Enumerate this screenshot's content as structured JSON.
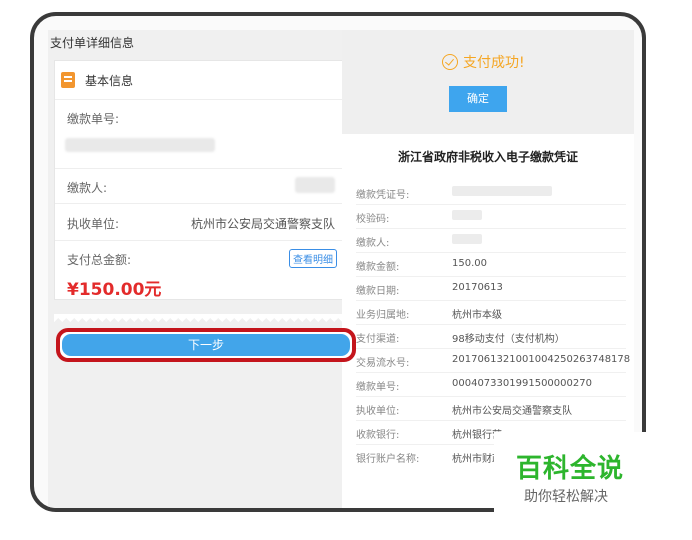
{
  "left": {
    "title": "支付单详细信息",
    "section": "基本信息",
    "rows": {
      "payment_no_label": "缴款单号:",
      "payer_label": "缴款人:",
      "unit_label": "执收单位:",
      "unit_value": "杭州市公安局交通警察支队",
      "total_label": "支付总金额:",
      "detail_button": "查看明细",
      "amount": "¥150.00元"
    },
    "next_button": "下一步"
  },
  "right": {
    "success_text": "支付成功!",
    "confirm_button": "确定",
    "voucher_title": "浙江省政府非税收入电子缴款凭证",
    "rows": [
      {
        "key": "缴款凭证号:",
        "value": ""
      },
      {
        "key": "校验码:",
        "value": ""
      },
      {
        "key": "缴款人:",
        "value": ""
      },
      {
        "key": "缴款金额:",
        "value": "150.00"
      },
      {
        "key": "缴款日期:",
        "value": "20170613"
      },
      {
        "key": "业务归属地:",
        "value": "杭州市本级"
      },
      {
        "key": "支付渠道:",
        "value": "98移动支付（支付机构）"
      },
      {
        "key": "交易流水号:",
        "value": "20170613210010042502637481​78"
      },
      {
        "key": "缴款单号:",
        "value": "000407330199150000027​0"
      },
      {
        "key": "执收单位:",
        "value": "杭州市公安局交通警察支队"
      },
      {
        "key": "收款银行:",
        "value": "杭州银行营"
      },
      {
        "key": "银行账户名称:",
        "value": "杭州市财政"
      }
    ]
  },
  "watermark": {
    "title": "百科全说",
    "subtitle": "助你轻松解决"
  },
  "colors": {
    "accent_blue": "#42a5ea",
    "success_orange": "#f5a623",
    "amount_red": "#e32b2b",
    "highlight_red": "#c4151c"
  }
}
